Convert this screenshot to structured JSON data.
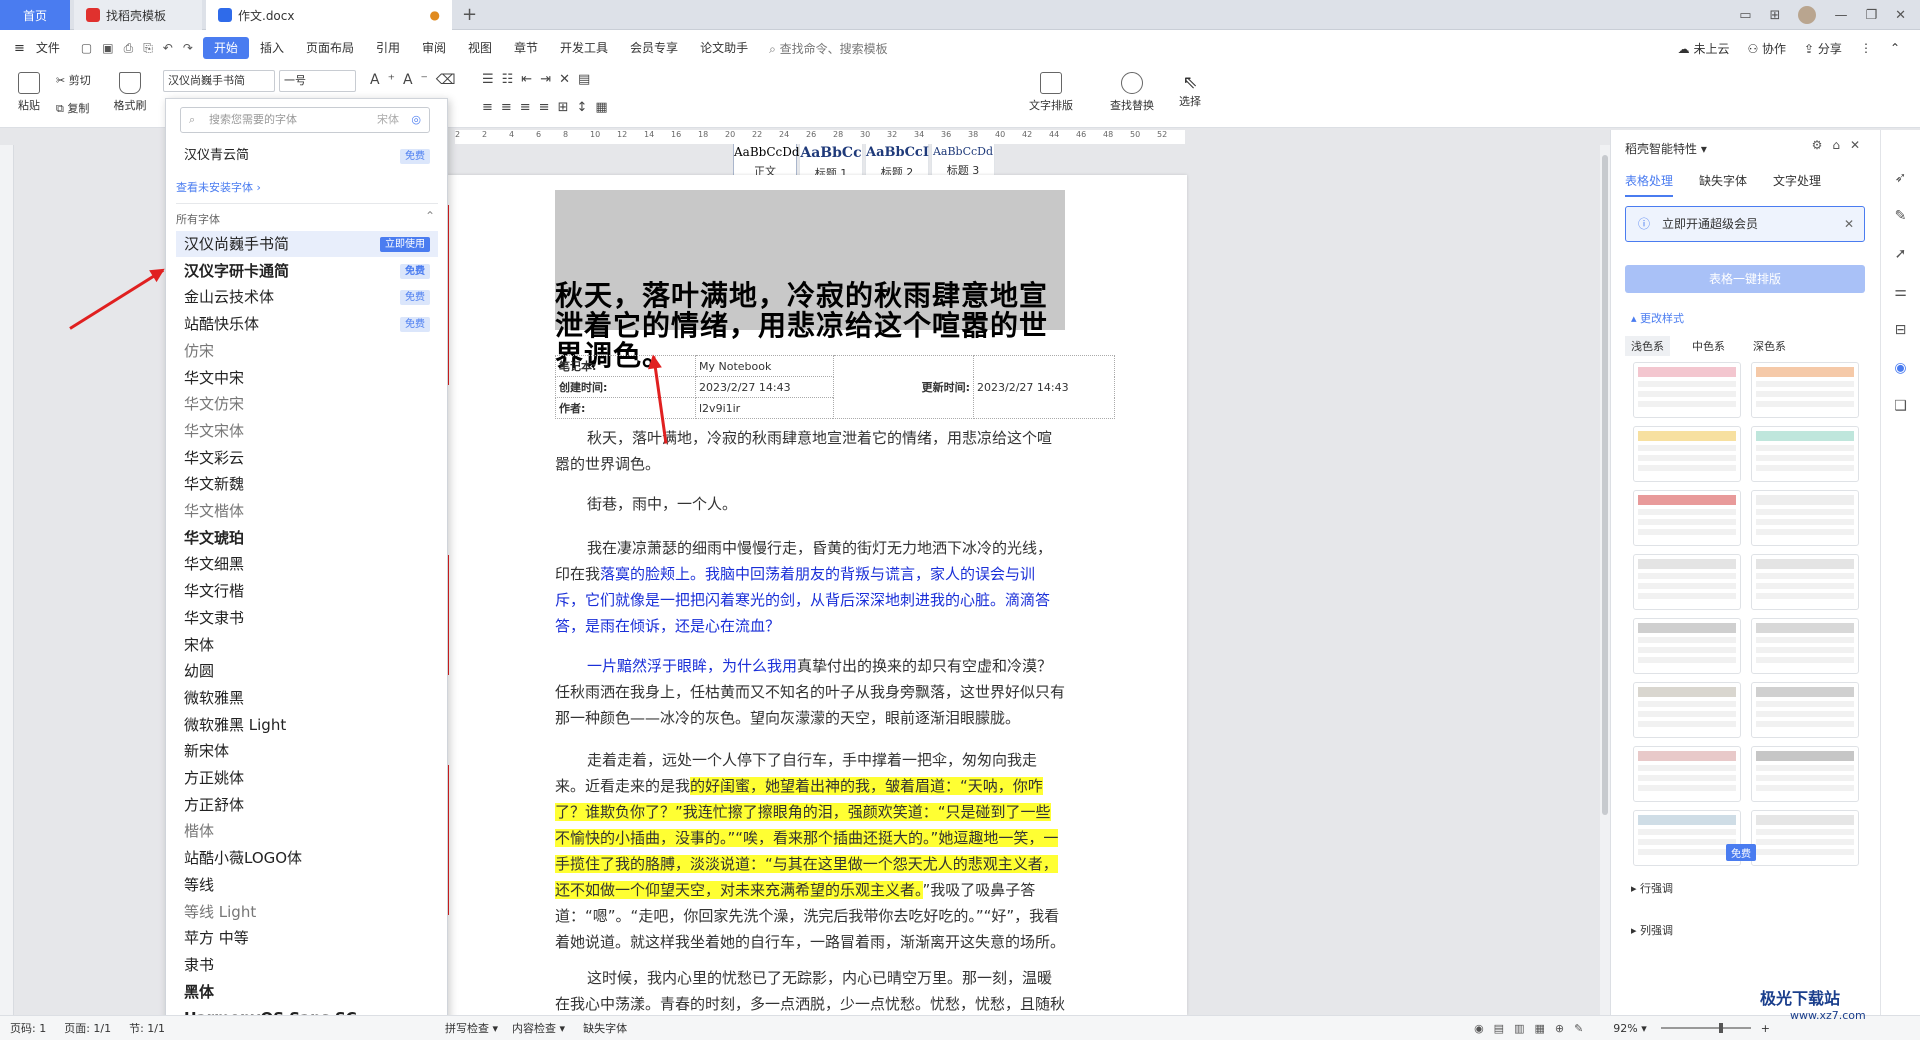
{
  "tabs": {
    "home": "首页",
    "template": "找稻壳模板",
    "doc": "作文.docx"
  },
  "menu": [
    "文件",
    "开始",
    "插入",
    "页面布局",
    "引用",
    "审阅",
    "视图",
    "章节",
    "开发工具",
    "会员专享",
    "论文助手"
  ],
  "menu_search": "查找命令、搜索模板",
  "menu_right": {
    "cloud": "未上云",
    "collab": "协作",
    "share": "分享"
  },
  "toolbar": {
    "paste": "粘贴",
    "cut": "剪切",
    "copy": "复制",
    "format_painter": "格式刷",
    "font_name": "汉仪尚巍手书简",
    "font_size": "一号",
    "styles": [
      {
        "sample": "AaBbCcDd",
        "label": "正文"
      },
      {
        "sample": "AaBbCc",
        "label": "标题 1"
      },
      {
        "sample": "AaBbCcI",
        "label": "标题 2"
      },
      {
        "sample": "AaBbCcDd",
        "label": "标题 3"
      }
    ],
    "text_layout": "文字排版",
    "find_replace": "查找替换",
    "select": "选择"
  },
  "ruler_ticks": [
    "2",
    "2",
    "4",
    "6",
    "8",
    "10",
    "12",
    "14",
    "16",
    "18",
    "20",
    "22",
    "24",
    "26",
    "28",
    "30",
    "32",
    "34",
    "36",
    "38",
    "40",
    "42",
    "44",
    "46",
    "48",
    "50",
    "52"
  ],
  "font_panel": {
    "search_placeholder": "搜索您需要的字体",
    "search_hint": "宋体",
    "recent": "汉仪青云简",
    "recent_badge": "免费",
    "show_uninstalled": "查看未安装字体",
    "all_fonts_label": "所有字体",
    "fonts": [
      {
        "name": "汉仪尚巍手书简",
        "badge": "立即使用"
      },
      {
        "name": "汉仪字研卡通简",
        "badge": "免费"
      },
      {
        "name": "金山云技术体",
        "badge": "免费"
      },
      {
        "name": "站酷快乐体",
        "badge": "免费"
      },
      {
        "name": "仿宋",
        "badge": ""
      },
      {
        "name": "华文中宋",
        "badge": ""
      },
      {
        "name": "华文仿宋",
        "badge": ""
      },
      {
        "name": "华文宋体",
        "badge": ""
      },
      {
        "name": "华文彩云",
        "badge": ""
      },
      {
        "name": "华文新魏",
        "badge": ""
      },
      {
        "name": "华文楷体",
        "badge": ""
      },
      {
        "name": "华文琥珀",
        "badge": ""
      },
      {
        "name": "华文细黑",
        "badge": ""
      },
      {
        "name": "华文行楷",
        "badge": ""
      },
      {
        "name": "华文隶书",
        "badge": ""
      },
      {
        "name": "宋体",
        "badge": ""
      },
      {
        "name": "幼圆",
        "badge": ""
      },
      {
        "name": "微软雅黑",
        "badge": ""
      },
      {
        "name": "微软雅黑 Light",
        "badge": ""
      },
      {
        "name": "新宋体",
        "badge": ""
      },
      {
        "name": "方正姚体",
        "badge": ""
      },
      {
        "name": "方正舒体",
        "badge": ""
      },
      {
        "name": "楷体",
        "badge": ""
      },
      {
        "name": "站酷小薇LOGO体",
        "badge": ""
      },
      {
        "name": "等线",
        "badge": ""
      },
      {
        "name": "等线 Light",
        "badge": ""
      },
      {
        "name": "苹方 中等",
        "badge": ""
      },
      {
        "name": "隶书",
        "badge": ""
      },
      {
        "name": "黑体",
        "badge": ""
      },
      {
        "name": "HarmonyOS Sans SC",
        "badge": ""
      }
    ]
  },
  "document": {
    "heading": "秋天，落叶满地，冷寂的秋雨肆意地宣泄着它的情绪，用悲凉给这个喧嚣的世界调色。",
    "info": {
      "notebook_label": "笔记本:",
      "notebook_value": "My Notebook",
      "created_label": "创建时间:",
      "created_value": "2023/2/27 14:43",
      "updated_label": "更新时间:",
      "updated_value": "2023/2/27 14:43",
      "author_label": "作者:",
      "author_value": "l2v9i1ir"
    },
    "p1": "秋天，落叶满地，冷寂的秋雨肆意地宣泄着它的情绪，用悲凉给这个喧嚣的世界调色。",
    "p2": "街巷，雨中，一个人。",
    "p3a": "我在凄凉萧瑟的细雨中慢慢行走，昏黄的街灯无力地洒下冰冷的光线，印在我",
    "p3b": "落寞的脸颊上。我脑中回荡着朋友的背叛与谎言，家人的误会与训斥，它们就像是一把把闪着寒光的剑，从背后深深地刺进我的心脏。滴滴答答，是雨在倾诉，还是心在流血？",
    "p4a": "一片黯然浮于眼眸，为什么我用",
    "p4b": "真挚付出的换来的却只有空虚和冷漠？任秋雨洒在我身上，任枯黄而又不知名的叶子从我身旁飘落，这世界好似只有那一种颜色——冰冷的灰色。望向灰濛濛的天空，眼前逐渐泪眼朦胧。",
    "p5a": "走着走着，远处一个人停下了自行车，手中撑着一把伞，匆匆向我走来。近看走来的是我",
    "p5b": "的好闺蜜，她望着出神的我，皱着眉道：“天呐，你咋了？谁欺负你了？”我连忙擦了擦眼角的泪，强颜欢笑道：“只是碰到了一些不愉快的小插曲，没事的。”“唉，看来那个插曲还挺大的。”她逗趣地一笑，一手揽住了我的胳膊，淡淡说道：“与其在这里做一个怨天尤人的悲观主义者，还不如做一个仰望天空，对未来充满希望的乐观主义者。",
    "p5c": "”我吸了吸鼻子答道：“嗯”。“走吧，你回家先洗个澡，洗完后我带你去吃好吃的。”“好”，我看着她说道。就这样我坐着她的自行车，一路冒着雨，渐渐离开这失意的场所。",
    "p6": "这时候，我内心里的忧愁已了无踪影，内心已晴空万里。那一刻，温暖在我心中荡漾。青春的时刻，多一点洒脱，少一点忧愁。忧愁，忧愁，且随秋风"
  },
  "right_panel": {
    "title": "稻壳智能特性",
    "tabs": [
      "表格处理",
      "缺失字体",
      "文字处理"
    ],
    "vip_notice": "立即开通超级会员",
    "one_click": "表格一键排版",
    "change_style": "更改样式",
    "color_tabs": [
      "浅色系",
      "中色系",
      "深色系"
    ],
    "free_badge": "免费",
    "row_emphasis": "行强调",
    "col_emphasis": "列强调"
  },
  "statusbar": {
    "page_num": "页码: 1",
    "pages": "页面: 1/1",
    "section": "节: 1/1",
    "spell": "拼写检查",
    "content_check": "内容检查",
    "missing_font": "缺失字体",
    "zoom": "92%"
  },
  "watermark": {
    "site": "极光下载站",
    "url": "www.xz7.com"
  },
  "colors": {
    "accent": "#4a7cf0",
    "arrow": "#e02020",
    "highlight": "#ffff33",
    "blue_text": "#1a2fd8"
  }
}
